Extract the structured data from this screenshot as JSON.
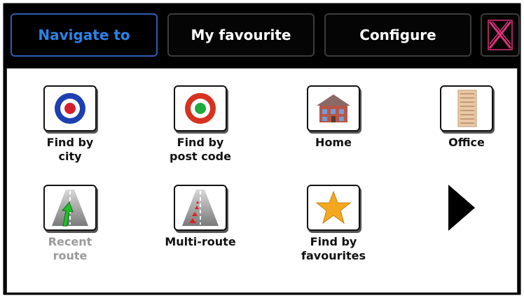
{
  "tabs": [
    {
      "label": "Navigate to",
      "active": true
    },
    {
      "label": "My favourite",
      "active": false
    },
    {
      "label": "Configure",
      "active": false
    }
  ],
  "close_icon": "close-x-icon",
  "menu": [
    {
      "label": "Find by\ncity",
      "icon": "city-target-icon",
      "disabled": false
    },
    {
      "label": "Find by\npost code",
      "icon": "postcode-target-icon",
      "disabled": false
    },
    {
      "label": "Home",
      "icon": "house-icon",
      "disabled": false
    },
    {
      "label": "Office",
      "icon": "office-building-icon",
      "disabled": false
    },
    {
      "label": "Recent\nroute",
      "icon": "recent-route-icon",
      "disabled": true
    },
    {
      "label": "Multi-route",
      "icon": "multi-route-icon",
      "disabled": false
    },
    {
      "label": "Find by\nfavourites",
      "icon": "star-icon",
      "disabled": false
    }
  ],
  "next_icon": "next-page-arrow-icon",
  "colors": {
    "active_tab_text": "#2a82e6",
    "active_tab_border": "#2f5db3",
    "close_icon": "#e0307a"
  }
}
